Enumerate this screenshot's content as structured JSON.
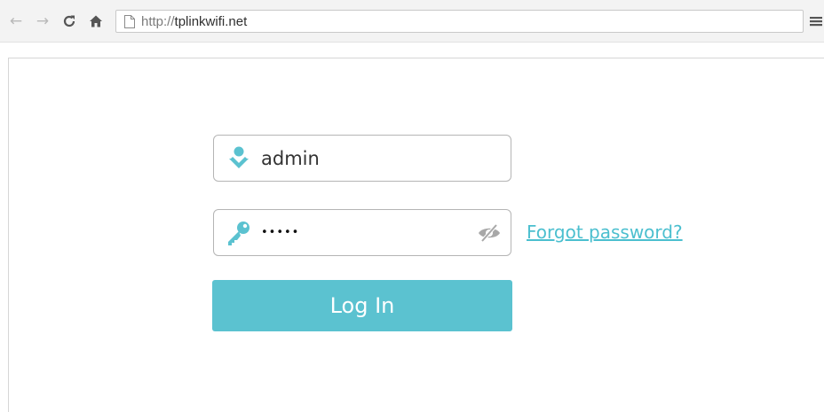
{
  "browser": {
    "url_protocol": "http://",
    "url_host": "tplinkwifi.net",
    "icons": {
      "back": "arrow-left-icon",
      "forward": "arrow-right-icon",
      "reload": "reload-icon",
      "home": "home-icon",
      "page": "page-icon",
      "menu": "hamburger-menu-icon"
    }
  },
  "login": {
    "username_value": "admin",
    "password_mask": "•••••",
    "forgot_password_label": "Forgot password?",
    "login_button_label": "Log In",
    "icons": {
      "username": "user-icon",
      "password": "key-icon",
      "show_password": "eye-slash-icon"
    }
  },
  "colors": {
    "accent": "#5bc2d0",
    "link": "#4bbfcf",
    "field_border": "#b5b5b5"
  }
}
